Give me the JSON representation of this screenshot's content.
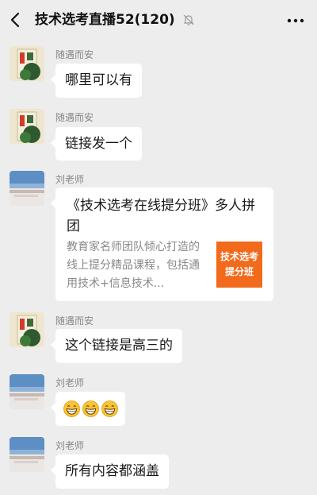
{
  "header": {
    "title": "技术选考直播52(120)",
    "back_icon": "chevron-left-icon",
    "mute_icon": "bell-off-icon",
    "more_icon": "ellipsis-icon"
  },
  "messages": [
    {
      "sender": "随遇而安",
      "text": "哪里可以有"
    },
    {
      "sender": "随遇而安",
      "text": "链接发一个"
    },
    {
      "sender": "刘老师",
      "card": {
        "title": "《技术选考在线提分班》多人拼团",
        "description": "教育家名师团队倾心打造的线上提分精品课程，包括通用技术+信息技术...",
        "thumbnail_line1": "技术选考",
        "thumbnail_line2": "提分班",
        "thumbnail_color": "#f26a1b"
      }
    },
    {
      "sender": "随遇而安",
      "text": "这个链接是高三的"
    },
    {
      "sender": "刘老师",
      "emoji": "grinning-face-icon",
      "emoji_count": 3
    },
    {
      "sender": "刘老师",
      "text": "所有内容都涵盖"
    }
  ],
  "colors": {
    "background": "#ededed",
    "bubble": "#ffffff",
    "sender_name": "#888888"
  }
}
